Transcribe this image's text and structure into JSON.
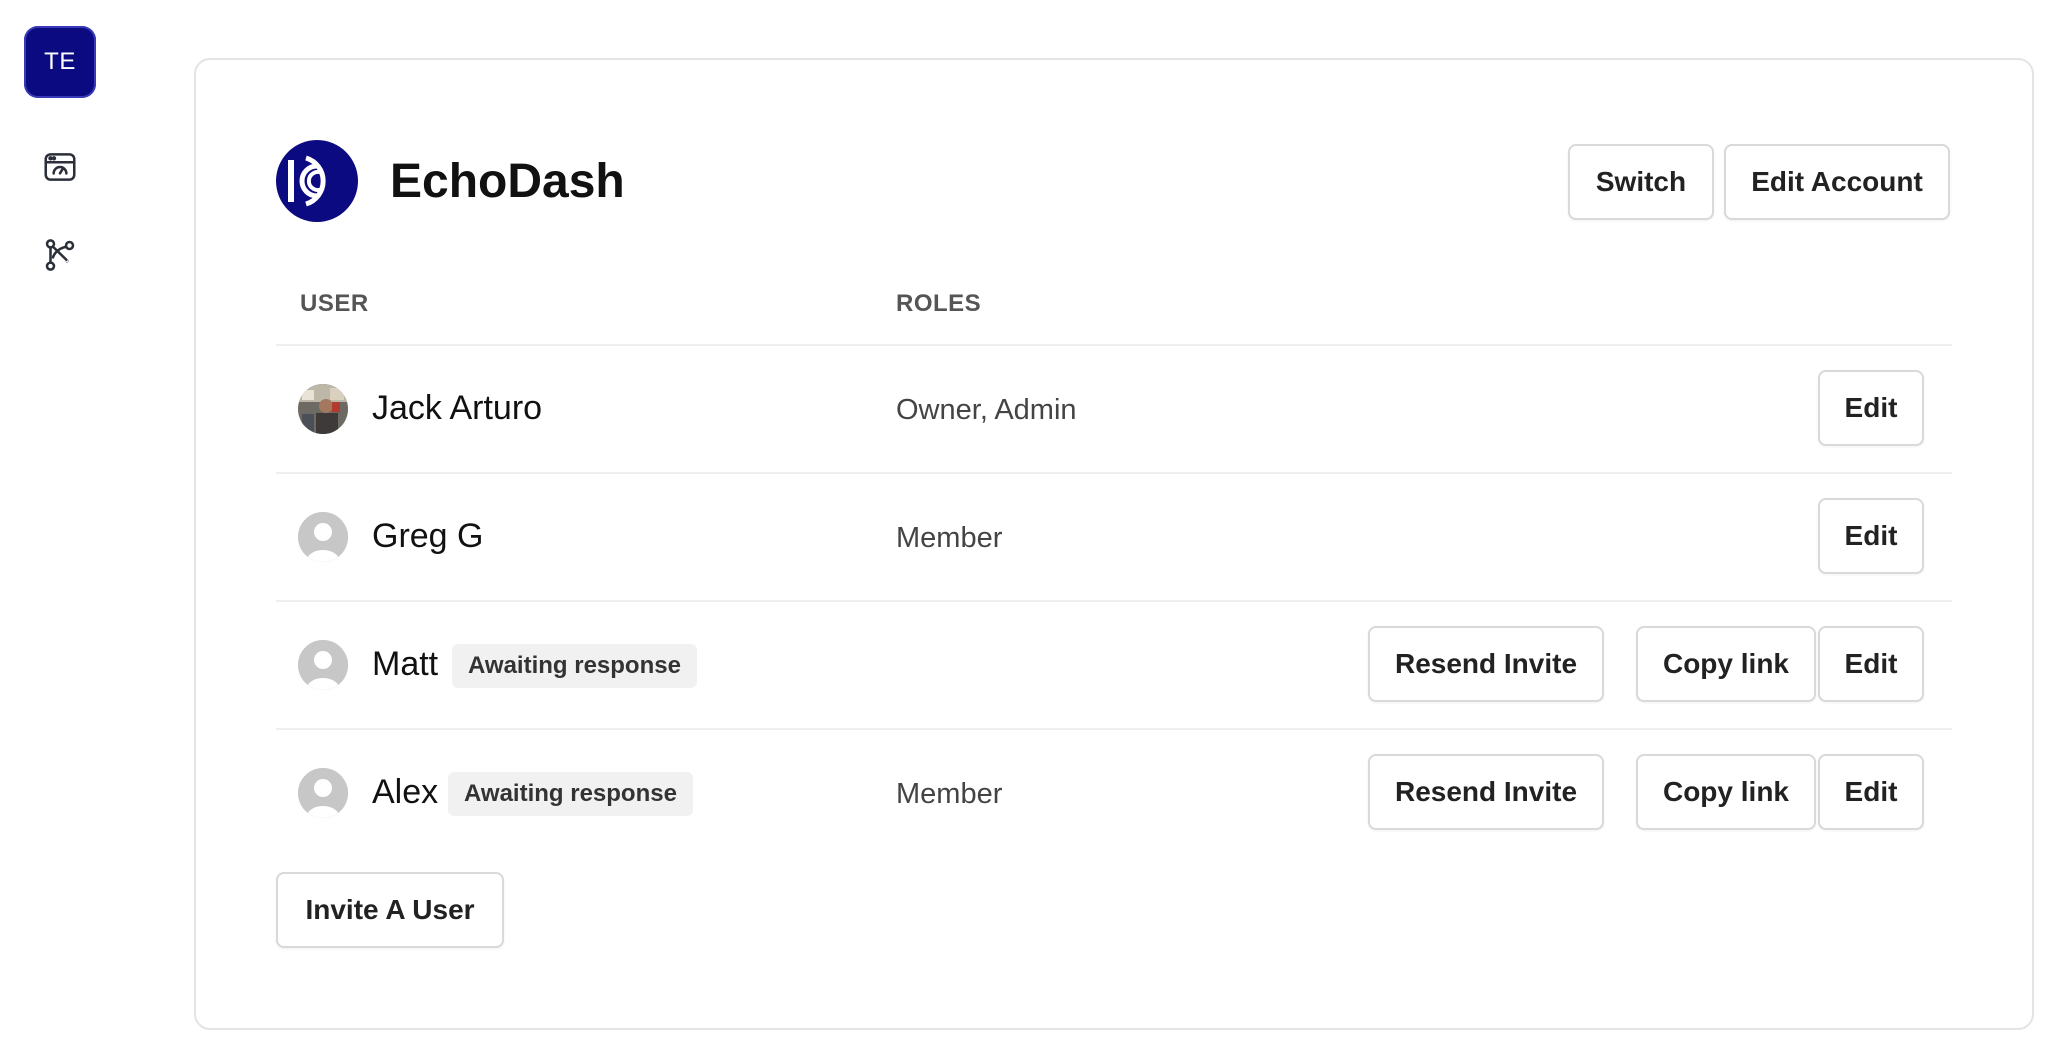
{
  "sidebar": {
    "workspace_initials": "TE",
    "workspace_color": "#0b0a80",
    "icons": [
      "dashboard-icon",
      "workflow-icon"
    ]
  },
  "organization": {
    "name": "EchoDash",
    "logo_color": "#0b0a80",
    "switch_label": "Switch",
    "edit_account_label": "Edit Account"
  },
  "table": {
    "columns": [
      "USER",
      "ROLES"
    ],
    "rows": [
      {
        "name": "Jack Arturo",
        "status": "",
        "roles": "Owner, Admin",
        "avatar": "photo",
        "actions": [
          "Edit"
        ]
      },
      {
        "name": "Greg G",
        "status": "",
        "roles": "Member",
        "avatar": "placeholder",
        "actions": [
          "Edit"
        ]
      },
      {
        "name": "Matt",
        "status": "Awaiting response",
        "roles": "",
        "avatar": "placeholder",
        "actions": [
          "Resend Invite",
          "Copy link",
          "Edit"
        ]
      },
      {
        "name": "Alex",
        "status": "Awaiting response",
        "roles": "Member",
        "avatar": "placeholder",
        "actions": [
          "Resend Invite",
          "Copy link",
          "Edit"
        ]
      }
    ]
  },
  "invite_label": "Invite A User"
}
